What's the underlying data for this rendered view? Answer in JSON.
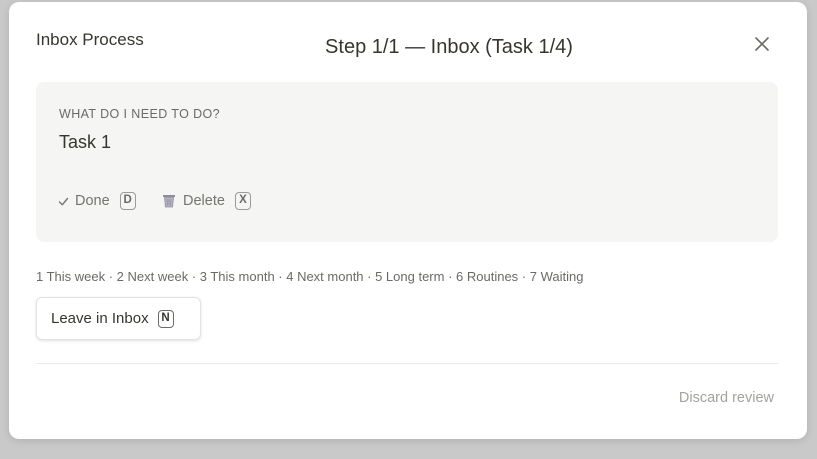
{
  "header": {
    "app_title": "Inbox Process",
    "step_title": "Step 1/1 — Inbox (Task 1/4)",
    "close_icon": "close-icon"
  },
  "task": {
    "question": "WHAT DO I NEED TO DO?",
    "name": "Task 1",
    "actions": [
      {
        "label": "Done",
        "shortcut": "D",
        "icon": "check-icon"
      },
      {
        "label": "Delete",
        "shortcut": "X",
        "icon": "trash-icon"
      }
    ]
  },
  "options_line": "1 This week · 2 Next week · 3 This month · 4 Next month · 5 Long term · 6 Routines · 7 Waiting",
  "leave_button": {
    "label": "Leave in Inbox",
    "shortcut": "N"
  },
  "footer": {
    "discard_label": "Discard review"
  },
  "colors": {
    "text": "#37352f",
    "muted": "#75746f",
    "card_bg": "#f5f5f4",
    "discard": "#a3a29e"
  }
}
